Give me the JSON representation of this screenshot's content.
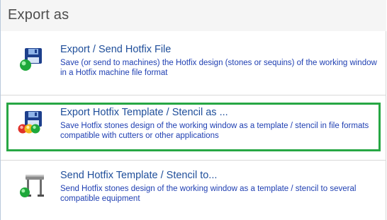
{
  "header": {
    "title": "Export as"
  },
  "items": [
    {
      "title": "Export / Send Hotfix File",
      "description": "Save (or send to machines) the Hotfix design (stones or sequins) of the working window in a Hotfix machine file format",
      "icon": "floppy-disk-green-ball-icon",
      "selected": false
    },
    {
      "title": "Export Hotfix Template / Stencil as ...",
      "description": "Save Hotfix stones design of the working window as a template / stencil in file formats compatible with cutters or other applications",
      "icon": "floppy-disk-color-balls-icon",
      "selected": true
    },
    {
      "title": "Send Hotfix Template / Stencil to...",
      "description": "Send Hotfix stones design of the working window as a template / stencil to several compatible equipment",
      "icon": "plotter-green-ball-icon",
      "selected": false
    }
  ],
  "colors": {
    "title_text": "#1f4e9a",
    "description_text": "#1f3fb2",
    "selection_border": "#27a744",
    "header_background": "#f5f5f5"
  }
}
